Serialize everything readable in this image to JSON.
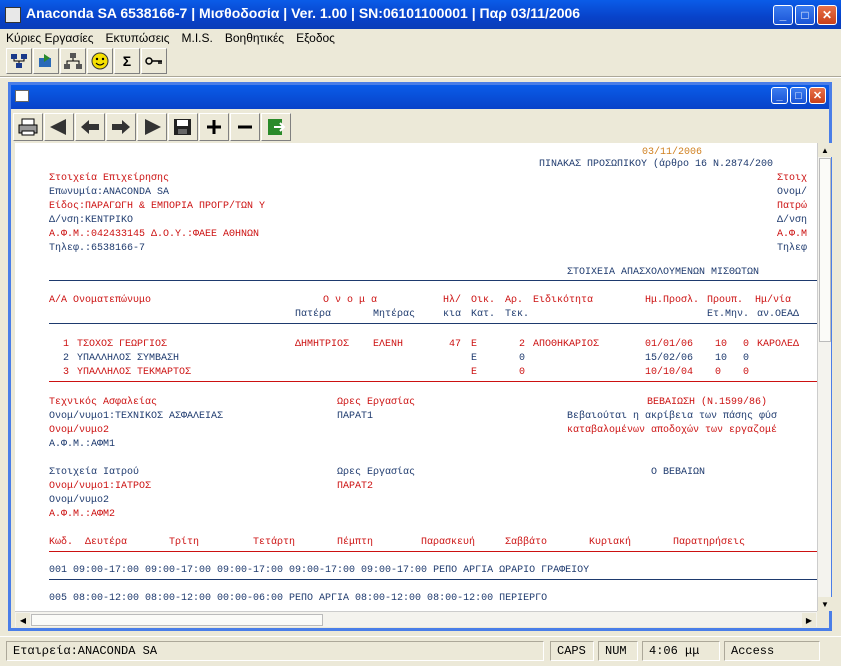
{
  "window": {
    "title": "Anaconda SA 6538166-7 | Μισθοδοσία | Ver. 1.00 | SN:06101100001 | Παρ 03/11/2006"
  },
  "menu": [
    "Κύριες Εργασίες",
    "Εκτυπώσεις",
    "M.I.S.",
    "Βοηθητικές",
    "Εξοδος"
  ],
  "toolbar_icons": [
    "org-chart-icon",
    "transfer-icon",
    "network-icon",
    "smiley-icon",
    "sigma-icon",
    "key-icon"
  ],
  "report_toolbar_icons": [
    "printer-icon",
    "first-page-icon",
    "previous-page-icon",
    "next-page-icon",
    "last-page-icon",
    "save-icon",
    "zoom-in-icon",
    "zoom-out-icon",
    "exit-icon"
  ],
  "report": {
    "date": "03/11/2006",
    "heading": "ΠΙΝΑΚΑΣ ΠΡΟΣΩΠΙΚΟΥ (άρθρο 16 Ν.2874/200",
    "company_section": "Στοιχεία Επιχείρησης",
    "company_lines": [
      "Επωνυμία:ANACONDA SA",
      "Είδος:ΠΑΡΑΓΩΓΗ & ΕΜΠΟΡΙΑ ΠΡΟΓΡ/ΤΩΝ Υ",
      "Δ/νση:ΚΕΝΤΡΙΚΟ",
      "Α.Φ.Μ.:042433145 Δ.Ο.Υ.:ΦΑΕΕ ΑΘΗΝΩΝ",
      "Τηλεφ.:6538166-7"
    ],
    "right_cut": [
      "Στοιχ",
      "Ονομ/",
      "Πατρώ",
      "Δ/νση",
      "Α.Φ.Μ",
      "Τηλεφ"
    ],
    "employees_heading": "ΣΤΟΙΧΕΙΑ ΑΠΑΣΧΟΛΟΥΜΕΝΩΝ ΜΙΣΘΩΤΩΝ",
    "col_headers": {
      "aa": "Α/Α Ονοματεπώνυμο",
      "onoma": "Ο ν ο μ α",
      "kl": "Ηλ/",
      "oik": "Οικ.",
      "ar": "Αρ.",
      "spec": "Ειδικότητα",
      "hire": "Ημ.Προσλ.",
      "prev": "Προυπ.",
      "daily": "Ημ/νία"
    },
    "col_headers2": {
      "father": "Πατέρα",
      "mother": "Μητέρας",
      "kia": "κια",
      "kat": "Κατ.",
      "tek": "Τεκ.",
      "etmin": "Ετ.Μην.",
      "an": "αν.ΟΕΑΔ"
    },
    "employees": [
      {
        "no": "1",
        "name": "ΤΣΟΧΟΣ ΓΕΩΡΓΙΟΣ",
        "father": "ΔΗΜΗΤΡΙΟΣ",
        "mother": "ΕΛΕΝΗ",
        "age": "47",
        "cat": "Ε",
        "kids": "2",
        "spec": "ΑΠΟΘΗΚΑΡΙΟΣ",
        "hire": "01/01/06",
        "y": "10",
        "m": "0",
        "extra": "ΚΑΡΟΛΕΔ"
      },
      {
        "no": "2",
        "name": "ΥΠΑΛΛΗΛΟΣ ΣΥΜΒΑΣΗ",
        "father": "",
        "mother": "",
        "age": "",
        "cat": "Ε",
        "kids": "0",
        "spec": "",
        "hire": "15/02/06",
        "y": "10",
        "m": "0",
        "extra": ""
      },
      {
        "no": "3",
        "name": "ΥΠΑΛΛΗΛΟΣ ΤΕΚΜΑΡΤΟΣ",
        "father": "",
        "mother": "",
        "age": "",
        "cat": "Ε",
        "kids": "0",
        "spec": "",
        "hire": "10/10/04",
        "y": "0",
        "m": "0",
        "extra": ""
      }
    ],
    "tech_section": "Τεχνικός Ασφαλείας",
    "tech_lines": [
      "Ονομ/νυμο1:ΤΕΧΝΙΚΟΣ ΑΣΦΑΛΕΙΑΣ",
      "Ονομ/νυμο2",
      "Α.Φ.Μ.:ΑΦΜ1"
    ],
    "work_hours_label": "Ωρες Εργασίας",
    "tech_hours": "ΠΑΡΑΤ1",
    "certification": "ΒΕΒΑΙΩΣΗ (Ν.1599/86)",
    "cert_lines": [
      "Βεβαιούται η ακρίβεια των πάσης φύσ",
      "καταβαλομένων αποδοχών των εργαζομέ"
    ],
    "doctor_section": "Στοιχεία Ιατρού",
    "doctor_lines": [
      "Ονομ/νυμο1:ΙΑΤΡΟΣ",
      "Ονομ/νυμο2",
      "Α.Φ.Μ.:ΑΦΜ2"
    ],
    "doctor_hours": "ΠΑΡΑΤ2",
    "signer": "Ο ΒΕΒΑΙΩΝ",
    "schedule_headers": [
      "Κωδ.",
      "Δευτέρα",
      "Τρίτη",
      "Τετάρτη",
      "Πέμπτη",
      "Παρασκευή",
      "Σαββάτο",
      "Κυριακή",
      "Παρατηρήσεις"
    ],
    "schedule": [
      "001  09:00-17:00 09:00-17:00 09:00-17:00 09:00-17:00 09:00-17:00       ΡΕΠΟ        ΑΡΓΙΑ ΩΡΑΡΙΟ ΓΡΑΦΕΙΟΥ",
      "005  08:00-12:00 08:00-12:00 00:00-06:00        ΡΕΠΟ        ΑΡΓΙΑ 08:00-12:00 08:00-12:00 ΠΕΡΙΕΡΓΟ"
    ]
  },
  "status": {
    "company": "Εταιρεία:ANACONDA SA",
    "caps": "CAPS",
    "num": "NUM",
    "time": "4:06 μμ",
    "db": "Access"
  }
}
